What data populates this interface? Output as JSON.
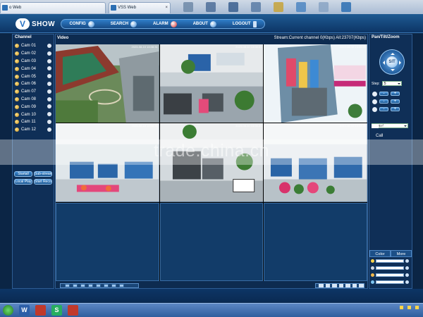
{
  "browser": {
    "tabs": [
      {
        "title": "o Web"
      },
      {
        "title": "VSS Web"
      }
    ],
    "window_buttons": [
      "–",
      "□",
      "✕"
    ]
  },
  "app": {
    "logo_letter": "V",
    "logo_text": "SHOW",
    "nav": [
      {
        "label": "CONFIG",
        "icon": "config-icon"
      },
      {
        "label": "SEARCH",
        "icon": "search-icon"
      },
      {
        "label": "ALARM",
        "icon": "alarm-icon"
      },
      {
        "label": "ABOUT",
        "icon": "about-icon"
      },
      {
        "label": "LOGOUT",
        "icon": "logout-icon"
      }
    ]
  },
  "left": {
    "header": "Channel",
    "cameras": [
      "Cam 01",
      "Cam 02",
      "Cam 03",
      "Cam 04",
      "Cam 05",
      "Cam 06",
      "Cam 07",
      "Cam 08",
      "Cam 09",
      "Cam 10",
      "Cam 11",
      "Cam 12"
    ],
    "buttons": [
      "Startall",
      "Sub-stream",
      "Local Play",
      "Start Record"
    ]
  },
  "video": {
    "header": "Video",
    "stream_info": "Stream:Current channel 0(Kbps) All:23707(Kbps)",
    "timestamp": "2023-08-10 13:08:31",
    "cells": [
      "campus",
      "office-a",
      "promo",
      "lab",
      "office-b",
      "hall",
      "empty",
      "empty",
      "empty"
    ]
  },
  "ptz": {
    "header": "Pan/Tilt/Zoom",
    "center_label": "SIT",
    "step_label": "Step:",
    "step_value": "5",
    "preset_value": "Preset",
    "value_label": "value(1~255)",
    "call_label": "Call"
  },
  "color": {
    "tab_color": "Color",
    "tab_more": "More"
  },
  "watermark": "trade.china.cn",
  "taskbar": {
    "apps": [
      {
        "label": "",
        "color": "#2f9e44"
      },
      {
        "label": "W",
        "color": "#2b5ea8"
      },
      {
        "label": "",
        "color": "#c0392b"
      },
      {
        "label": "S",
        "color": "#27ae60"
      },
      {
        "label": "",
        "color": "#c0392b"
      }
    ]
  }
}
